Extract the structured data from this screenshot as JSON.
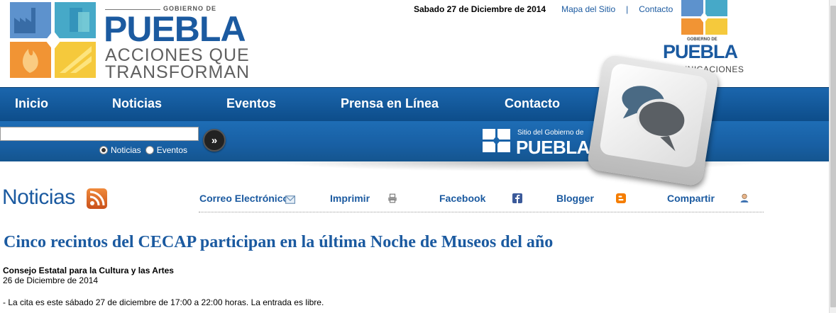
{
  "header": {
    "logo": {
      "small": "GOBIERNO DE",
      "big": "PUEBLA",
      "line1": "ACCIONES QUE",
      "line2": "TRANSFORMAN"
    },
    "date": "Sabado 27 de Diciembre de 2014",
    "links": [
      "Mapa del Sitio",
      "Contacto"
    ],
    "separator": "|",
    "comm_logo": {
      "small": "GOBIERNO DE",
      "big": "PUEBLA",
      "sub": "COMUNICACIONES"
    }
  },
  "nav": {
    "items": [
      "Inicio",
      "Noticias",
      "Eventos",
      "Prensa en Línea",
      "Contacto"
    ]
  },
  "search": {
    "value": "",
    "go_icon": "»",
    "options": [
      {
        "label": "Noticias",
        "checked": true
      },
      {
        "label": "Eventos",
        "checked": false
      }
    ]
  },
  "sitio": {
    "small": "Sitio del Gobierno de",
    "big": "PUEBLA"
  },
  "section": {
    "title": "Noticias",
    "tools": [
      "Correo Electrónico",
      "Imprimir",
      "Facebook",
      "Blogger",
      "Compartir"
    ]
  },
  "article": {
    "headline": "Cinco recintos del CECAP participan en la última Noche de Museos del año",
    "org": "Consejo Estatal para la Cultura y las Artes",
    "date": "26 de Diciembre de 2014",
    "lead": "- La cita es este sábado 27 de diciembre de 17:00 a 22:00 horas. La entrada es libre."
  },
  "colors": {
    "brand_blue": "#1b5aa0",
    "nav_blue": "#0f5494",
    "tile_blue": "#2f7fc2",
    "tile_green": "#6fc3b4",
    "tile_orange": "#f29a34",
    "tile_yellow": "#f4cf3a"
  }
}
